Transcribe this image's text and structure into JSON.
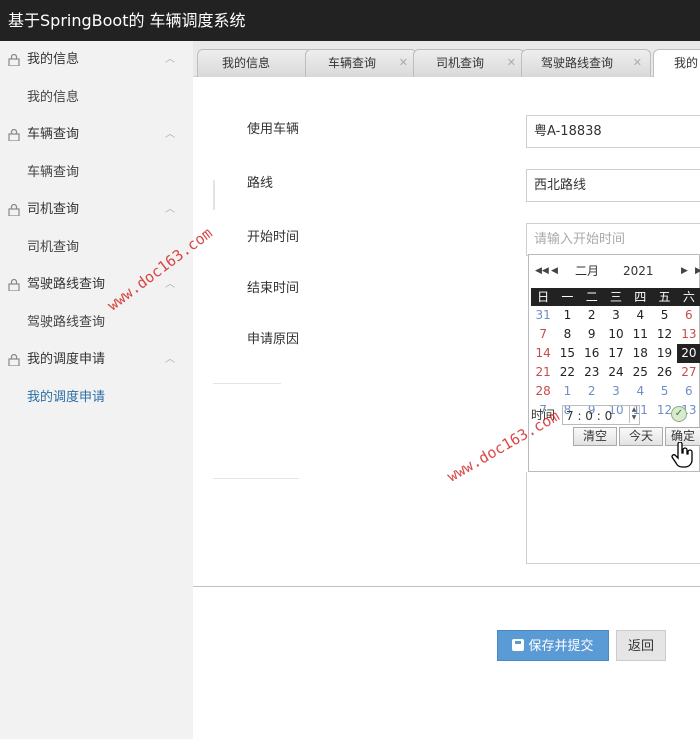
{
  "app": {
    "title": "基于SpringBoot的 车辆调度系统"
  },
  "sidebar": {
    "groups": [
      {
        "label": "我的信息",
        "sub": "我的信息"
      },
      {
        "label": "车辆查询",
        "sub": "车辆查询"
      },
      {
        "label": "司机查询",
        "sub": "司机查询"
      },
      {
        "label": "驾驶路线查询",
        "sub": "驾驶路线查询"
      },
      {
        "label": "我的调度申请",
        "sub": "我的调度申请"
      }
    ]
  },
  "tabs": [
    "我的信息",
    "车辆查询",
    "司机查询",
    "驾驶路线查询",
    "我的"
  ],
  "form": {
    "vehicle_label": "使用车辆",
    "vehicle_value": "粤A-18838",
    "route_label": "路线",
    "route_value": "西北路线",
    "start_label": "开始时间",
    "start_placeholder": "请输入开始时间",
    "end_label": "结束时间",
    "reason_label": "申请原因"
  },
  "calendar": {
    "month": "二月",
    "year": "2021",
    "weekdays": [
      "日",
      "一",
      "二",
      "三",
      "四",
      "五",
      "六"
    ],
    "rows": [
      [
        "31",
        "1",
        "2",
        "3",
        "4",
        "5",
        "6"
      ],
      [
        "7",
        "8",
        "9",
        "10",
        "11",
        "12",
        "13"
      ],
      [
        "14",
        "15",
        "16",
        "17",
        "18",
        "19",
        "20"
      ],
      [
        "21",
        "22",
        "23",
        "24",
        "25",
        "26",
        "27"
      ],
      [
        "28",
        "1",
        "2",
        "3",
        "4",
        "5",
        "6"
      ],
      [
        "7",
        "8",
        "9",
        "10",
        "11",
        "12",
        "13"
      ]
    ],
    "time_label": "时间",
    "time_value": "7 : 0 : 0",
    "clear_label": "清空",
    "today_label": "今天",
    "ok_label": "确定",
    "selected_day": "20"
  },
  "buttons": {
    "save": "保存并提交",
    "back": "返回"
  },
  "watermark": "www.doc163.com"
}
